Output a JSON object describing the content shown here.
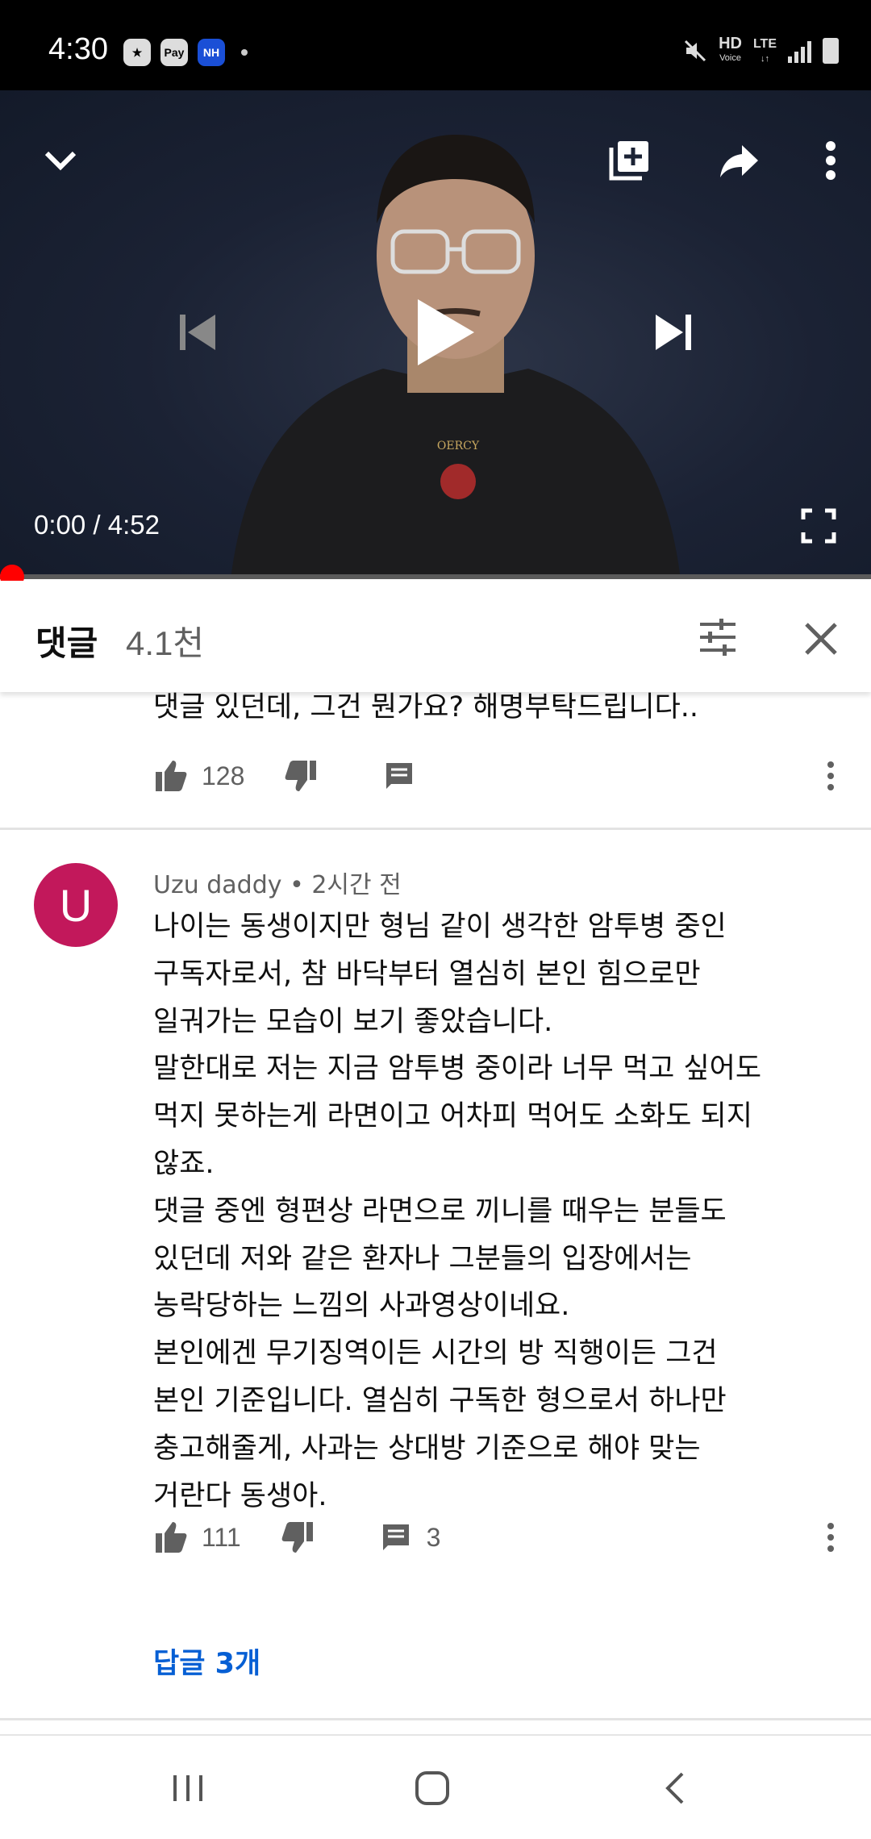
{
  "status_bar": {
    "time": "4:30",
    "app_icons": [
      "star-icon",
      "Pay",
      "NH"
    ],
    "network": "HD",
    "network_sub": "Voice",
    "lte": "LTE"
  },
  "player": {
    "time_current": "0:00",
    "time_separator": " / ",
    "time_total": "4:52",
    "progress_fraction": 0.0,
    "shirt_text": "OERCY"
  },
  "comments_header": {
    "title": "댓글",
    "count": "4.1천"
  },
  "comments": [
    {
      "text": "댓글 있던데, 그건 뭔가요? 해명부탁드립니다..",
      "likes": "128",
      "reply_count": ""
    },
    {
      "avatar_letter": "U",
      "avatar_color": "#c2185b",
      "author": "Uzu daddy",
      "separator": " • ",
      "time": "2시간 전",
      "text": "나이는 동생이지만 형님 같이 생각한 암투병 중인\n구독자로서, 참 바닥부터 열심히 본인 힘으로만\n일궈가는 모습이 보기 좋았습니다.\n말한대로 저는 지금 암투병 중이라 너무 먹고 싶어도\n먹지 못하는게 라면이고 어차피 먹어도 소화도 되지\n않죠.\n댓글 중엔 형편상 라면으로 끼니를 때우는 분들도\n있던데 저와 같은 환자나 그분들의 입장에서는\n농락당하는 느낌의 사과영상이네요.\n본인에겐 무기징역이든 시간의 방 직행이든 그건\n본인 기준입니다. 열심히 구독한 형으로서 하나만\n충고해줄게, 사과는 상대방 기준으로 해야 맞는\n거란다 동생아.",
      "likes": "111",
      "reply_count": "3",
      "replies_link": "답글 3개"
    }
  ],
  "colors": {
    "accent_red": "#ff0000",
    "link_blue": "#065fd4"
  }
}
